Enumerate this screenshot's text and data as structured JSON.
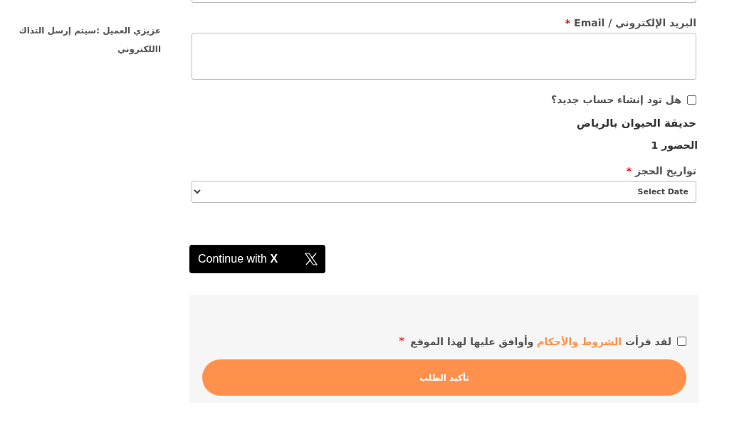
{
  "sidebar": {
    "lines": [
      "عزيزي العميل :سيتم إرسل التذاك",
      "االلكتروني"
    ]
  },
  "email": {
    "label": "البريد الإلكتروني / Email",
    "required_mark": "*"
  },
  "create_account": {
    "label": "هل تود إنشاء حساب جديد؟",
    "checked": false
  },
  "event": {
    "title": "حديقة الحيوان بالرياض",
    "attendance": "الحضور 1"
  },
  "dates": {
    "label": "تواريخ الحجز",
    "required_mark": "*",
    "value": "Select Date"
  },
  "social": {
    "label": "Continue with",
    "brand": "X"
  },
  "terms": {
    "before": "لقد قرأت ",
    "link": "الشروط والأحكام",
    "after": " وأوافق عليها لهذا الموقع",
    "required_mark": "*",
    "checked": false
  },
  "submit": {
    "label": "تأكيد الطلب"
  }
}
